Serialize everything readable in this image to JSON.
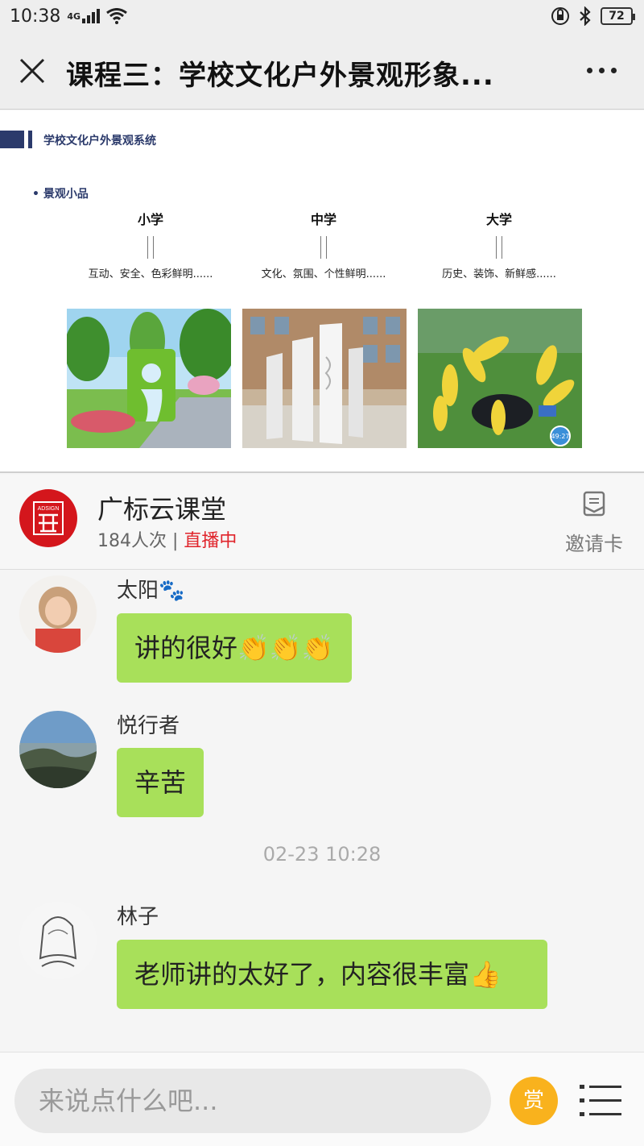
{
  "status_bar": {
    "time": "10:38",
    "network": "4G",
    "battery": "72"
  },
  "header": {
    "title": "课程三：学校文化户外景观形象..."
  },
  "slide": {
    "system_title": "学校文化户外景观系统",
    "section": "• 景观小品",
    "columns": [
      {
        "heading": "小学",
        "desc": "互动、安全、色彩鲜明......"
      },
      {
        "heading": "中学",
        "desc": "文化、氛围、个性鲜明......"
      },
      {
        "heading": "大学",
        "desc": "历史、装饰、新鲜感......"
      }
    ],
    "badge": "49:27"
  },
  "channel": {
    "name": "广标云课堂",
    "views": "184人次",
    "separator": " | ",
    "status": "直播中",
    "invite_label": "邀请卡",
    "logo_text": "ADSIGN"
  },
  "messages": [
    {
      "user": "太阳🐾",
      "text": "讲的很好👏👏👏"
    },
    {
      "user": "悦行者",
      "text": "辛苦"
    },
    {
      "timestamp": "02-23 10:28"
    },
    {
      "user": "林子",
      "text": "老师讲的太好了，内容很丰富👍"
    }
  ],
  "footer": {
    "placeholder": "来说点什么吧...",
    "reward_label": "赏"
  },
  "colors": {
    "bubble": "#a8e05a",
    "live": "#e0242b",
    "reward": "#f9b21d",
    "logo": "#d4161c",
    "slide_accent": "#2b3a6b"
  }
}
